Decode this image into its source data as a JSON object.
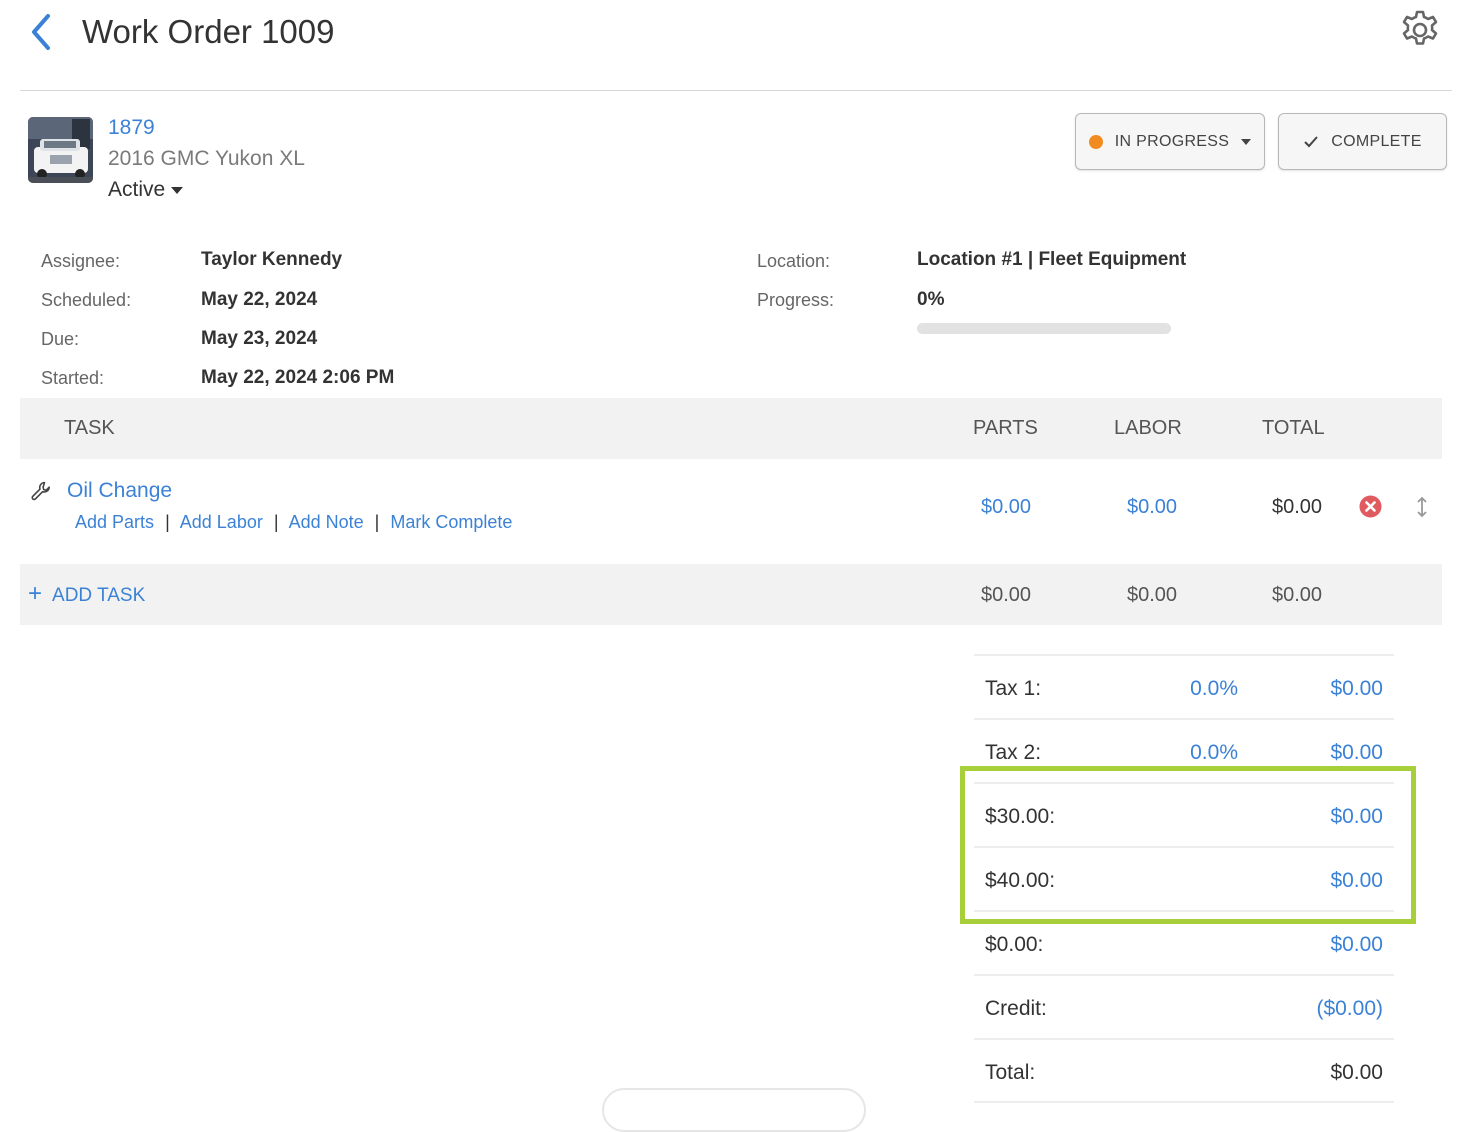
{
  "header": {
    "title": "Work Order 1009"
  },
  "vehicle": {
    "id": "1879",
    "name": "2016 GMC Yukon XL",
    "status": "Active"
  },
  "actions": {
    "status_label": "IN PROGRESS",
    "status_color": "#f28b1f",
    "complete_label": "COMPLETE"
  },
  "details": {
    "assignee_label": "Assignee:",
    "assignee": "Taylor Kennedy",
    "scheduled_label": "Scheduled:",
    "scheduled": "May 22, 2024",
    "due_label": "Due:",
    "due": "May 23, 2024",
    "started_label": "Started:",
    "started": "May 22, 2024 2:06 PM",
    "location_label": "Location:",
    "location": "Location #1 | Fleet Equipment",
    "progress_label": "Progress:",
    "progress_text": "0%",
    "progress_value": 0
  },
  "table": {
    "headers": {
      "task": "TASK",
      "parts": "PARTS",
      "labor": "LABOR",
      "total": "TOTAL"
    },
    "tasks": [
      {
        "name": "Oil Change",
        "links": [
          "Add Parts",
          "Add Labor",
          "Add Note",
          "Mark Complete"
        ],
        "parts": "$0.00",
        "labor": "$0.00",
        "total": "$0.00"
      }
    ],
    "add_task_label": "ADD TASK",
    "subtotals": {
      "parts": "$0.00",
      "labor": "$0.00",
      "total": "$0.00"
    }
  },
  "totals": [
    {
      "label": "Tax 1:",
      "pct": "0.0%",
      "value": "$0.00"
    },
    {
      "label": "Tax 2:",
      "pct": "0.0%",
      "value": "$0.00"
    },
    {
      "label": "$30.00:",
      "value": "$0.00"
    },
    {
      "label": "$40.00:",
      "value": "$0.00"
    },
    {
      "label": "$0.00:",
      "value": "$0.00"
    },
    {
      "label": "Credit:",
      "value": "($0.00)"
    },
    {
      "label": "Total:",
      "value": "$0.00"
    }
  ],
  "colors": {
    "accent": "#3b82d6",
    "highlight": "#a7cf3a",
    "delete": "#e05b60"
  }
}
